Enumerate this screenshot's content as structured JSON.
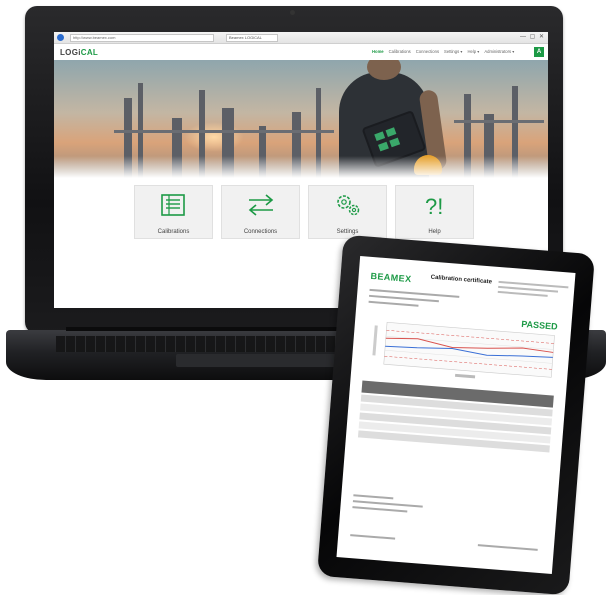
{
  "browser": {
    "url": "http://www.beamex.com",
    "tab_title": "Beamex LOGiCAL",
    "window_controls": "— ▢ ✕"
  },
  "site": {
    "logo_prefix": "LOGi",
    "logo_suffix": "CAL",
    "nav": [
      "Home",
      "Calibrations",
      "Connections",
      "Settings ▾",
      "Help ▾",
      "Administrators ▾"
    ],
    "nav_cta": "A"
  },
  "tiles": [
    {
      "label": "Calibrations",
      "icon": "list-icon"
    },
    {
      "label": "Connections",
      "icon": "arrows-exchange-icon"
    },
    {
      "label": "Settings",
      "icon": "gears-icon"
    },
    {
      "label": "Help",
      "icon": "question-exclamation-icon"
    }
  ],
  "tablet": {
    "brand": "BEAMEX",
    "doc_title": "Calibration certificate",
    "result": "PASSED"
  },
  "colors": {
    "brand_green": "#1d9a46",
    "laptop_body": "#1b1b1d",
    "chart_series_red": "#d9534f",
    "chart_series_blue": "#3a6fd6"
  }
}
